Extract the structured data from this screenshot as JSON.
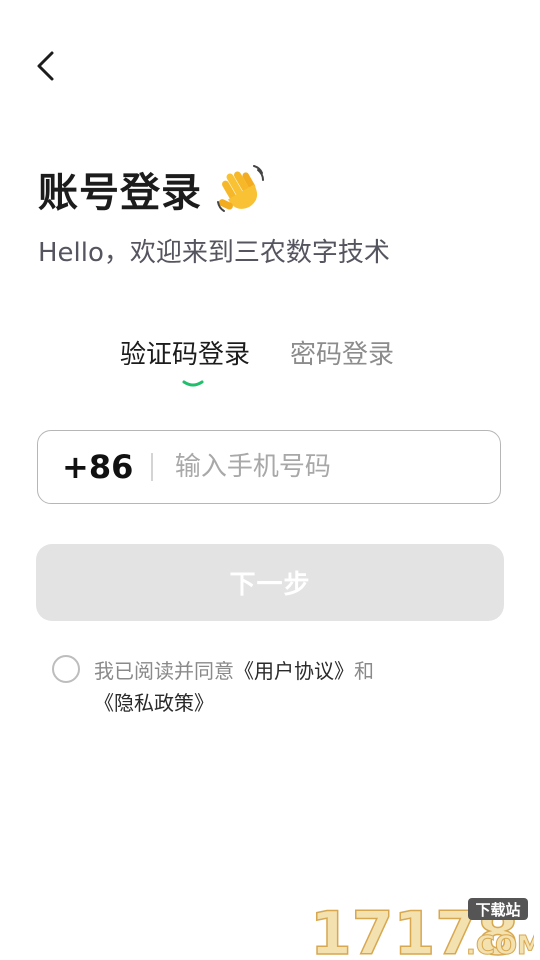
{
  "header": {
    "back_icon": "chevron-left-icon"
  },
  "title": {
    "text": "账号登录",
    "emoji_icon": "waving-hand-icon"
  },
  "subtitle": "Hello，欢迎来到三农数字技术",
  "tabs": [
    {
      "label": "验证码登录",
      "active": true
    },
    {
      "label": "密码登录",
      "active": false
    }
  ],
  "phone": {
    "country_code": "+86",
    "placeholder": "输入手机号码",
    "value": ""
  },
  "next_button": {
    "label": "下一步",
    "enabled": false
  },
  "agreement": {
    "prefix": "我已阅读并同意",
    "user_agreement": "《用户协议》",
    "conjunction": "和",
    "privacy_policy": "《隐私政策》",
    "checked": false
  },
  "watermark": {
    "brand": "17178",
    "domain": ".COM",
    "tag": "下载站"
  },
  "colors": {
    "accent": "#1fbf6b",
    "button_disabled": "#e3e3e3",
    "text_primary": "#1c1c1c",
    "text_secondary": "#8a8a8a"
  }
}
